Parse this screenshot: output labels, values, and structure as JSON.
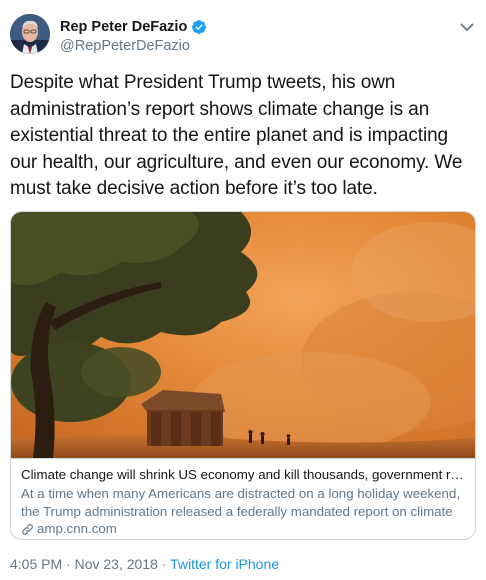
{
  "author": {
    "display_name": "Rep Peter DeFazio",
    "handle": "@RepPeterDeFazio",
    "verified": true
  },
  "tweet": {
    "text": "Despite what President Trump tweets, his own administration’s report shows climate change is an existential threat to the entire planet and is impacting our health, our agriculture, and even our economy. We must take decisive action before it’s too late."
  },
  "card": {
    "title": "Climate change will shrink US economy and kill thousands, government report ...",
    "description": "At a time when many Americans are distracted on a long holiday weekend, the Trump administration released a federally mandated report on climate change ...",
    "domain": "amp.cnn.com"
  },
  "footer": {
    "time": "4:05 PM",
    "separator": " · ",
    "date": "Nov 23, 2018",
    "source": "Twitter for iPhone"
  },
  "colors": {
    "text": "#14171a",
    "secondary": "#657786",
    "link": "#1b95e0",
    "verified": "#1da1f2",
    "border": "#ccd6dd"
  },
  "icons": [
    "verified-badge-icon",
    "chevron-down-icon",
    "link-icon"
  ]
}
